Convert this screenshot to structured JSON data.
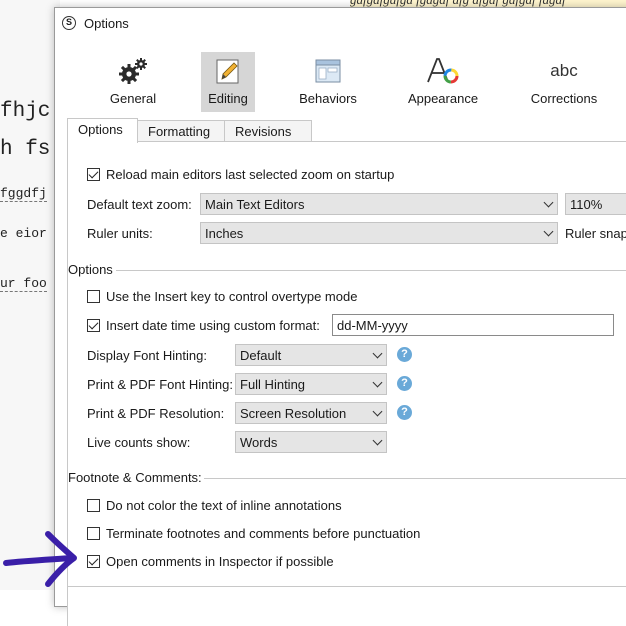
{
  "background": {
    "doc_lines": [
      "fhjc",
      "h fs",
      "fggdfj",
      "e eior",
      "ur foo"
    ],
    "top_strip_text": "gdfgdfgdfgd fgdgdf dfg dfgdf gdfgdf fdgdf"
  },
  "window": {
    "title": "Options",
    "app_icon": "S"
  },
  "toolbar": [
    {
      "label": "General",
      "icon": "gears-icon"
    },
    {
      "label": "Editing",
      "icon": "pencil-icon"
    },
    {
      "label": "Behaviors",
      "icon": "window-icon"
    },
    {
      "label": "Appearance",
      "icon": "font-color-icon"
    },
    {
      "label": "Corrections",
      "icon": "abc-icon",
      "icon_text": "abc"
    }
  ],
  "active_toolbar": "Editing",
  "tabs": [
    "Options",
    "Formatting",
    "Revisions"
  ],
  "active_tab": "Options",
  "general": {
    "reload_zoom": {
      "label": "Reload main editors last selected zoom on startup",
      "checked": true
    },
    "default_zoom": {
      "label": "Default text zoom:",
      "editor": "Main Text Editors",
      "zoom": "110%"
    },
    "ruler": {
      "label": "Ruler units:",
      "value": "Inches",
      "snap_label": "Ruler snap"
    }
  },
  "options_section": {
    "title": "Options",
    "insert_key": {
      "label": "Use the Insert key to control overtype mode",
      "checked": false
    },
    "date_time": {
      "label": "Insert date time using custom format:",
      "checked": true,
      "format": "dd-MM-yyyy"
    },
    "display_hinting": {
      "label": "Display Font Hinting:",
      "value": "Default"
    },
    "print_hinting": {
      "label": "Print & PDF Font Hinting:",
      "value": "Full Hinting"
    },
    "print_resolution": {
      "label": "Print & PDF Resolution:",
      "value": "Screen Resolution"
    },
    "live_counts": {
      "label": "Live counts show:",
      "value": "Words"
    },
    "help_glyph": "?"
  },
  "footnote_section": {
    "title": "Footnote & Comments:",
    "items": [
      {
        "label": "Do not color the text of inline annotations",
        "checked": false
      },
      {
        "label": "Terminate footnotes and comments before punctuation",
        "checked": false
      },
      {
        "label": "Open comments in Inspector if possible",
        "checked": true
      }
    ]
  },
  "colors": {
    "annotation_arrow": "#3a1fa8",
    "active_toolbar_bg": "#d6d6d6",
    "help_icon": "#6aa9d8"
  }
}
